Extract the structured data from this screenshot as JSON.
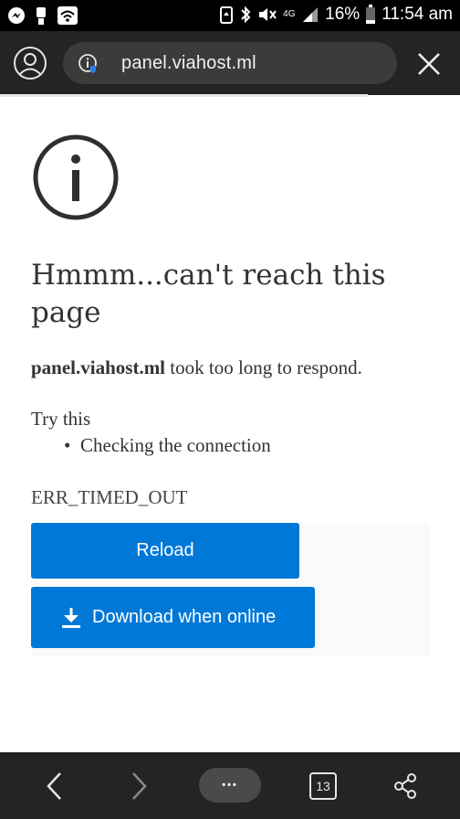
{
  "status_bar": {
    "battery_percent": "16%",
    "time": "11:54 am",
    "network": "4G",
    "icons": [
      "messenger-icon",
      "alert-icon",
      "wifi-icon",
      "battery-saver-icon",
      "bluetooth-icon",
      "mute-icon",
      "signal-icon",
      "battery-icon"
    ]
  },
  "url_bar": {
    "url": "panel.viahost.ml",
    "icons": [
      "profile-icon",
      "site-info-icon",
      "close-icon"
    ]
  },
  "error_page": {
    "title": "Hmmm...can't reach this page",
    "host": "panel.viahost.ml",
    "message": " took too long to respond.",
    "try_heading": "Try this",
    "suggestions": [
      "Checking the connection"
    ],
    "error_code": "ERR_TIMED_OUT",
    "reload_label": "Reload",
    "download_label": "Download when online"
  },
  "bottom_bar": {
    "more_label": "•••",
    "tab_count": "13",
    "icons": [
      "back-icon",
      "forward-icon",
      "more-icon",
      "tabs-icon",
      "share-icon"
    ]
  },
  "colors": {
    "accent": "#0078d7",
    "toolbar": "#242424",
    "url_pill": "#3b3b3b",
    "text": "#333333"
  }
}
